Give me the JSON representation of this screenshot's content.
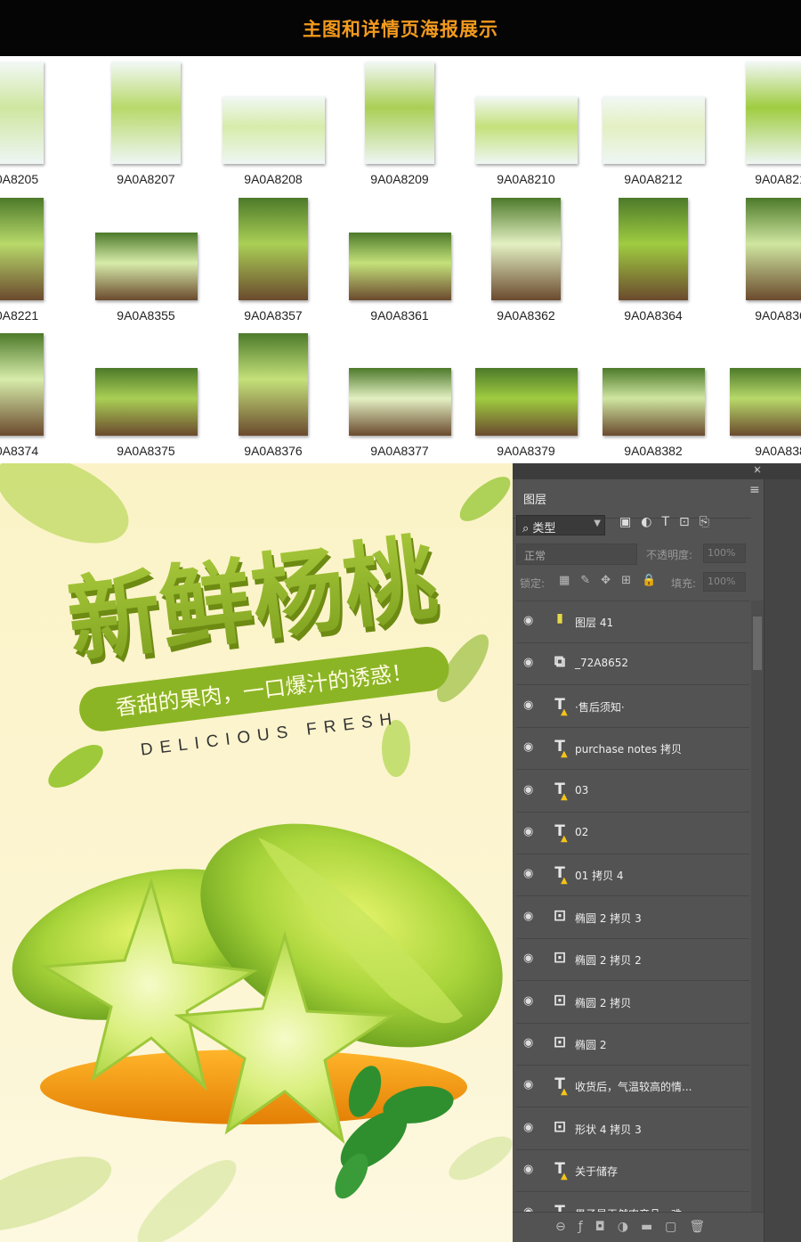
{
  "banner": {
    "title": "主图和详情页海报展示"
  },
  "thumbnails": {
    "row1": [
      "0A8205",
      "9A0A8207",
      "9A0A8208",
      "9A0A8209",
      "9A0A8210",
      "9A0A8212",
      "9A0A821"
    ],
    "row2": [
      "0A8221",
      "9A0A8355",
      "9A0A8357",
      "9A0A8361",
      "9A0A8362",
      "9A0A8364",
      "9A0A836"
    ],
    "row3": [
      "0A8374",
      "9A0A8375",
      "9A0A8376",
      "9A0A8377",
      "9A0A8379",
      "9A0A8382",
      "9A0A838"
    ]
  },
  "poster": {
    "title": "新鲜杨桃",
    "subtitle": "香甜的果肉，一口爆汁的诱惑！",
    "english": "DELICIOUS FRESH"
  },
  "layers_panel": {
    "tab_label": "图层",
    "menu_icon": "panel-menu-icon",
    "filter_kind": "类型",
    "blend_mode": "正常",
    "opacity_label": "不透明度:",
    "opacity_value": "100%",
    "lock_label": "锁定:",
    "fill_label": "填充:",
    "fill_value": "100%",
    "layers": [
      {
        "name": "图层 41",
        "type": "pixel"
      },
      {
        "name": "_72A8652",
        "type": "smart-object"
      },
      {
        "name": "·售后须知·",
        "type": "text"
      },
      {
        "name": "purchase notes 拷贝",
        "type": "text"
      },
      {
        "name": "03",
        "type": "text"
      },
      {
        "name": "02",
        "type": "text"
      },
      {
        "name": "01 拷贝 4",
        "type": "text"
      },
      {
        "name": "椭圆 2 拷贝 3",
        "type": "shape"
      },
      {
        "name": "椭圆 2 拷贝 2",
        "type": "shape"
      },
      {
        "name": "椭圆 2 拷贝",
        "type": "shape"
      },
      {
        "name": "椭圆 2",
        "type": "shape"
      },
      {
        "name": "收货后，气温较高的情...",
        "type": "text"
      },
      {
        "name": "形状 4 拷贝 3",
        "type": "shape"
      },
      {
        "name": "关于储存",
        "type": "text"
      },
      {
        "name": "果子是天然农产品，难...",
        "type": "text"
      }
    ]
  },
  "colors": {
    "banner_bg": "#050505",
    "banner_text": "#f39a1d",
    "panel_bg": "#535353",
    "fruit_green": "#9ccc2f"
  }
}
